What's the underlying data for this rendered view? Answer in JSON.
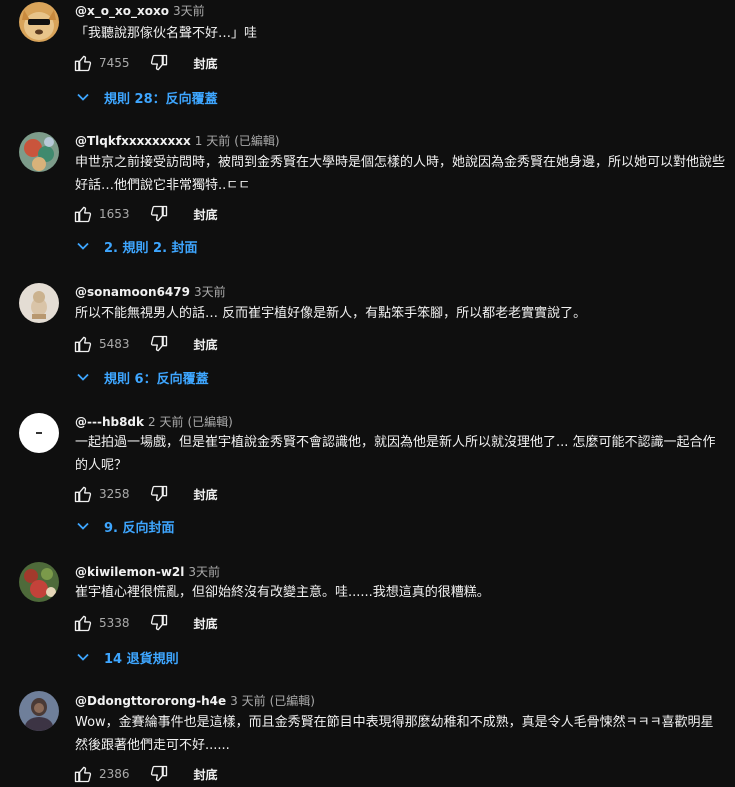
{
  "comments": [
    {
      "author": "@x_o_xo_xoxo",
      "time": "3天前",
      "edited": "",
      "text": "「我聽說那傢伙名聲不好…」哇",
      "likes": "7455",
      "reply_label": "封底",
      "replies_label": "規則 28：反向覆蓋"
    },
    {
      "author": "@Tlqkfxxxxxxxxx",
      "time": "1 天前",
      "edited": "(已編輯)",
      "text": "申世京之前接受訪問時，被問到金秀賢在大學時是個怎樣的人時，她說因為金秀賢在她身邊，所以她可以對他說些好話…他們說它非常獨特..ㄷㄷ",
      "likes": "1653",
      "reply_label": "封底",
      "replies_label": "2. 規則 2. 封面"
    },
    {
      "author": "@sonamoon6479",
      "time": "3天前",
      "edited": "",
      "text": "所以不能無視男人的話… 反而崔宇植好像是新人，有點笨手笨腳，所以都老老實實說了。",
      "likes": "5483",
      "reply_label": "封底",
      "replies_label": "規則 6：反向覆蓋"
    },
    {
      "author": "@---hb8dk",
      "time": "2 天前",
      "edited": "(已編輯)",
      "text": "一起拍過一場戲，但是崔宇植說金秀賢不會認識他，就因為他是新人所以就沒理他了... 怎麼可能不認識一起合作的人呢？",
      "likes": "3258",
      "reply_label": "封底",
      "replies_label": "9. 反向封面"
    },
    {
      "author": "@kiwilemon-w2l",
      "time": "3天前",
      "edited": "",
      "text": "崔宇植心裡很慌亂，但卻始終沒有改變主意。哇......我想這真的很糟糕。",
      "likes": "5338",
      "reply_label": "封底",
      "replies_label": "14 退貨規則"
    },
    {
      "author": "@Ddongttororong-h4e",
      "time": "3 天前",
      "edited": "(已編輯)",
      "text": "Wow，金賽綸事件也是這樣，而且金秀賢在節目中表現得那麼幼稚和不成熟，真是令人毛骨悚然ㅋㅋㅋ喜歡明星然後跟著他們走可不好......",
      "likes": "2386",
      "reply_label": "封底",
      "replies_label": ""
    }
  ],
  "icons": {
    "like": "thumbs-up-icon",
    "dislike": "thumbs-down-icon",
    "expand": "chevron-down-icon"
  },
  "colors": {
    "background": "#0f0f0f",
    "link": "#3ea6ff",
    "secondary_text": "#aaaaaa"
  }
}
